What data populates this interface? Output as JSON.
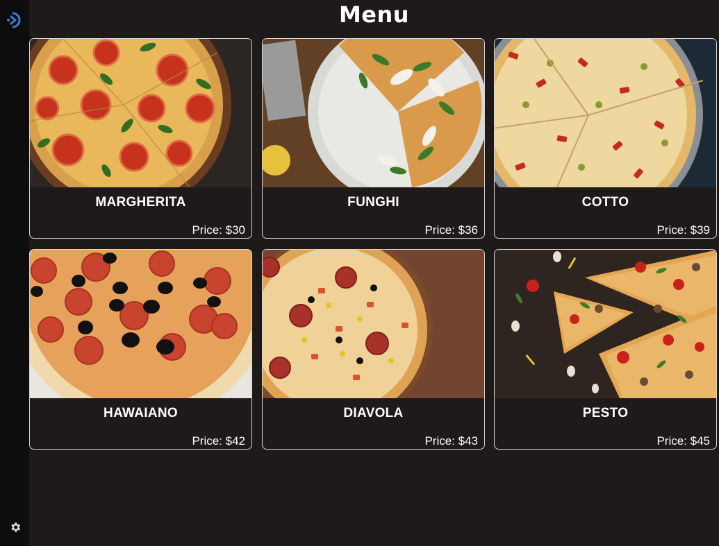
{
  "header": {
    "title": "Menu"
  },
  "sidebar": {
    "logo_icon": "app-logo-icon",
    "settings_icon": "gear-icon"
  },
  "price_prefix": "Price: ",
  "pizzas": [
    {
      "name": "MARGHERITA",
      "price": "$30"
    },
    {
      "name": "FUNGHI",
      "price": "$36"
    },
    {
      "name": "COTTO",
      "price": "$39"
    },
    {
      "name": "HAWAIANO",
      "price": "$42"
    },
    {
      "name": "DIAVOLA",
      "price": "$43"
    },
    {
      "name": "PESTO",
      "price": "$45"
    }
  ],
  "colors": {
    "background": "#1e1a19",
    "sidebar": "#0d0d0d",
    "accent": "#3d7bd9",
    "card_border": "#d6d6d6"
  }
}
